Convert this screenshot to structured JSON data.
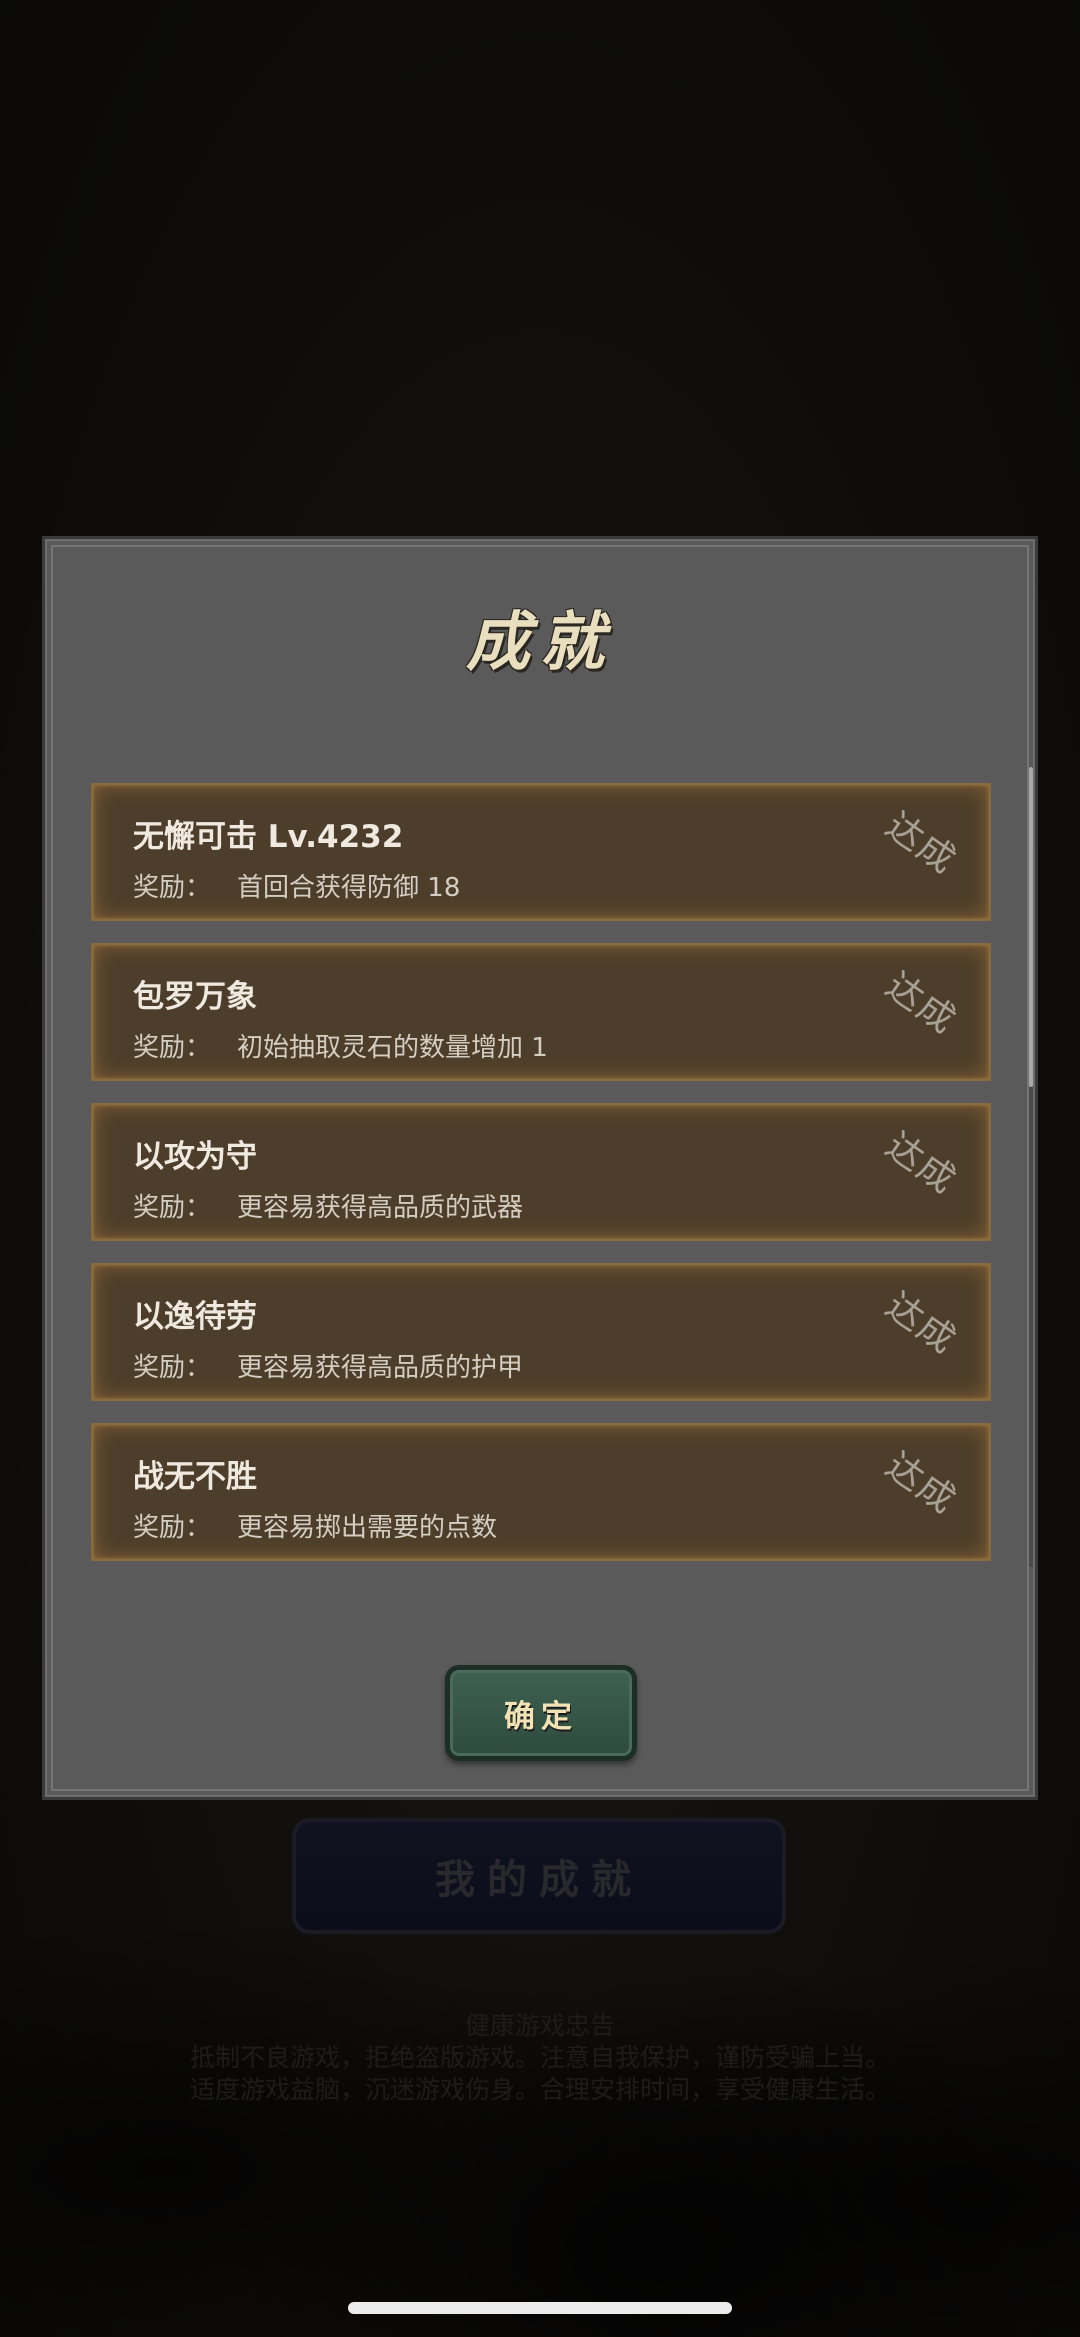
{
  "background": {
    "my_achievements_button": "我的成就",
    "health_notice": {
      "title": "健康游戏忠告",
      "line1": "抵制不良游戏，拒绝盗版游戏。注意自我保护，谨防受骗上当。",
      "line2": "适度游戏益脑，沉迷游戏伤身。合理安排时间，享受健康生活。"
    }
  },
  "dialog": {
    "title": "成就",
    "reward_label": "奖励：",
    "achievements": [
      {
        "name": "无懈可击 Lv.4232",
        "reward": "首回合获得防御 18",
        "status": "达成"
      },
      {
        "name": "包罗万象",
        "reward": "初始抽取灵石的数量增加 1",
        "status": "达成"
      },
      {
        "name": "以攻为守",
        "reward": "更容易获得高品质的武器",
        "status": "达成"
      },
      {
        "name": "以逸待劳",
        "reward": "更容易获得高品质的护甲",
        "status": "达成"
      },
      {
        "name": "战无不胜",
        "reward": "更容易掷出需要的点数",
        "status": "达成"
      }
    ],
    "confirm_button": "确定"
  }
}
